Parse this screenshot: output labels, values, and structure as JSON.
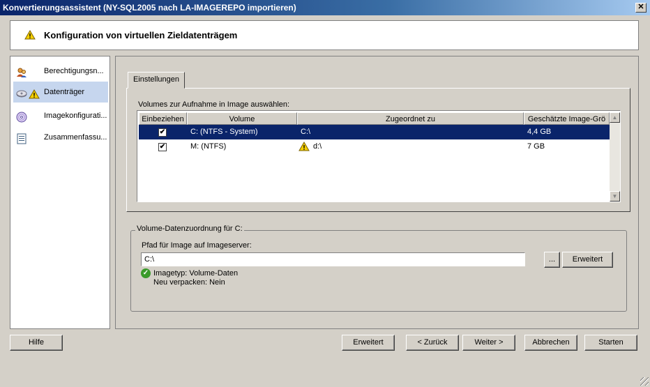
{
  "window": {
    "title": "Konvertierungsassistent (NY-SQL2005 nach LA-IMAGEREPO importieren)",
    "close_glyph": "✕"
  },
  "header": {
    "title": "Konfiguration von virtuellen Zieldatenträgem"
  },
  "nav": {
    "items": [
      {
        "label": "Berechtigungsn...",
        "icon": "users-icon"
      },
      {
        "label": "Datenträger",
        "icon": "disk-icon",
        "warning": true
      },
      {
        "label": "Imagekonfigurati...",
        "icon": "disc-icon"
      },
      {
        "label": "Zusammenfassu...",
        "icon": "document-icon"
      }
    ]
  },
  "tab": {
    "label": "Einstellungen"
  },
  "volumes": {
    "label": "Volumes zur Aufnahme in Image auswählen:",
    "columns": [
      "Einbeziehen",
      "Volume",
      "Zugeordnet zu",
      "Geschätzte Image-Grö"
    ],
    "rows": [
      {
        "included": true,
        "volume": "C: (NTFS - System)",
        "mapped": "C:\\",
        "size": "4,4 GB",
        "warning": false,
        "selected": true
      },
      {
        "included": true,
        "volume": "M: (NTFS)",
        "mapped": "d:\\",
        "size": "7 GB",
        "warning": true,
        "selected": false
      }
    ],
    "check_glyph": "✔"
  },
  "mapping": {
    "group_title": "Volume-Datenzuordnung für C:",
    "path_label": "Pfad für Image auf Imageserver:",
    "path_value": "C:\\",
    "browse_label": "...",
    "advanced_label": "Erweitert",
    "info_type": "Imagetyp: Volume-Daten",
    "info_repack": "Neu verpacken: Nein"
  },
  "footer": {
    "help_label": "Hilfe",
    "advanced_label": "Erweitert",
    "back_label": "< Zurück",
    "next_label": "Weiter >",
    "cancel_label": "Abbrechen",
    "start_label": "Starten"
  },
  "colors": {
    "selection": "#0a246a",
    "nav_selected": "#c6d6ee",
    "warning": "#f5d000",
    "ok": "#3a9a2a"
  }
}
